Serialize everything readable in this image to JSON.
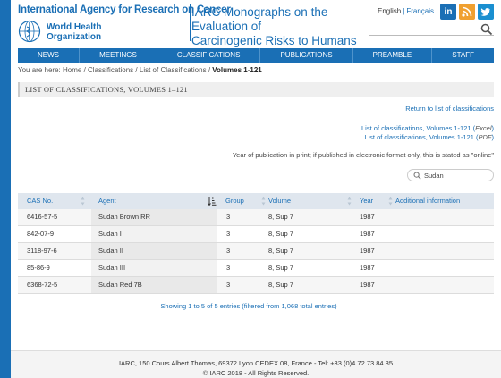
{
  "header": {
    "iarc_title": "International Agency for Research on Cancer",
    "who_line1": "World Health",
    "who_line2": "Organization",
    "monographs_line1": "IARC Monographs on the Evaluation of",
    "monographs_line2": "Carcinogenic Risks to Humans",
    "lang_en": "English",
    "lang_sep": "|",
    "lang_fr": "Français",
    "social_icons": [
      "linkedin-icon",
      "rss-icon",
      "twitter-icon"
    ]
  },
  "nav": {
    "items": [
      "NEWS",
      "MEETINGS",
      "CLASSIFICATIONS",
      "PUBLICATIONS",
      "PREAMBLE",
      "STAFF"
    ]
  },
  "breadcrumb": {
    "prefix": "You are here:",
    "home": "Home",
    "sep": "/",
    "classifications": "Classifications",
    "list": "List of Classifications",
    "current": "Volumes 1-121"
  },
  "section": {
    "title": "LIST OF CLASSIFICATIONS, VOLUMES 1–121"
  },
  "links": {
    "return": "Return to list of classifications",
    "excel_text": "List of classifications, Volumes 1-121",
    "excel_fmt": "Excel",
    "pdf_text": "List of classifications, Volumes 1-121",
    "pdf_fmt": "PDF"
  },
  "info_line": "Year of publication in print; if published in electronic format only, this is stated as \"online\"",
  "filter": {
    "value": "Sudan"
  },
  "table": {
    "columns": [
      "CAS No.",
      "Agent",
      "Group",
      "Volume",
      "Year",
      "Additional information"
    ],
    "rows": [
      [
        "6416-57-5",
        "Sudan Brown RR",
        "3",
        "8, Sup 7",
        "1987",
        ""
      ],
      [
        "842-07-9",
        "Sudan I",
        "3",
        "8, Sup 7",
        "1987",
        ""
      ],
      [
        "3118-97-6",
        "Sudan II",
        "3",
        "8, Sup 7",
        "1987",
        ""
      ],
      [
        "85-86-9",
        "Sudan III",
        "3",
        "8, Sup 7",
        "1987",
        ""
      ],
      [
        "6368-72-5",
        "Sudan Red 7B",
        "3",
        "8, Sup 7",
        "1987",
        ""
      ]
    ],
    "summary": "Showing 1 to 5 of 5 entries (filtered from 1,068 total entries)"
  },
  "footer": {
    "address": "IARC, 150 Cours Albert Thomas, 69372 Lyon CEDEX 08, France - Tel: +33 (0)4 72 73 84 85",
    "copyright": "© IARC 2018 - All Rights Reserved."
  },
  "colors": {
    "brand_blue": "#1a6fb5",
    "header_row": "#dfe6ee",
    "rss": "#f0a030"
  }
}
